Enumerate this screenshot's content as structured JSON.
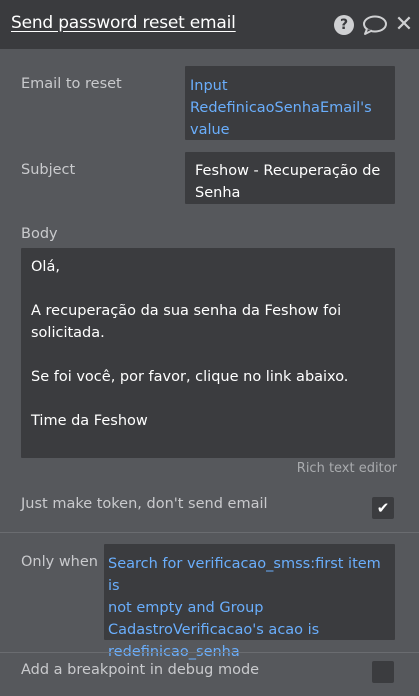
{
  "header": {
    "title": "Send password reset email",
    "help_icon": "question-circle-icon",
    "comment_icon": "speech-bubble-icon",
    "close_icon": "close-x-icon"
  },
  "email": {
    "label": "Email to reset",
    "value_lines": [
      "Input",
      "RedefinicaoSenhaEmail's",
      "value"
    ]
  },
  "subject": {
    "label": "Subject",
    "value_lines": [
      "Feshow - Recuperação de",
      "Senha"
    ]
  },
  "body": {
    "label": "Body",
    "lines": [
      "Olá,",
      "A recuperação da sua senha da Feshow foi solicitada.",
      "Se foi você, por favor, clique no link abaixo.",
      "Time da Feshow"
    ],
    "editor_hint": "Rich text editor"
  },
  "token": {
    "label": "Just make token, don't send email",
    "checked": true
  },
  "only_when": {
    "label": "Only when",
    "value_lines": [
      "Search for verificacao_smss:first item is",
      "not empty and Group",
      "CadastroVerificacao's acao is",
      "redefinicao_senha"
    ]
  },
  "breakpoint": {
    "label": "Add a breakpoint in debug mode",
    "checked": false
  },
  "colors": {
    "header_bg": "#3a3b3e",
    "panel_bg": "#56585c",
    "field_bg": "#3b3c3f",
    "dynamic_text": "#6aaefc"
  }
}
